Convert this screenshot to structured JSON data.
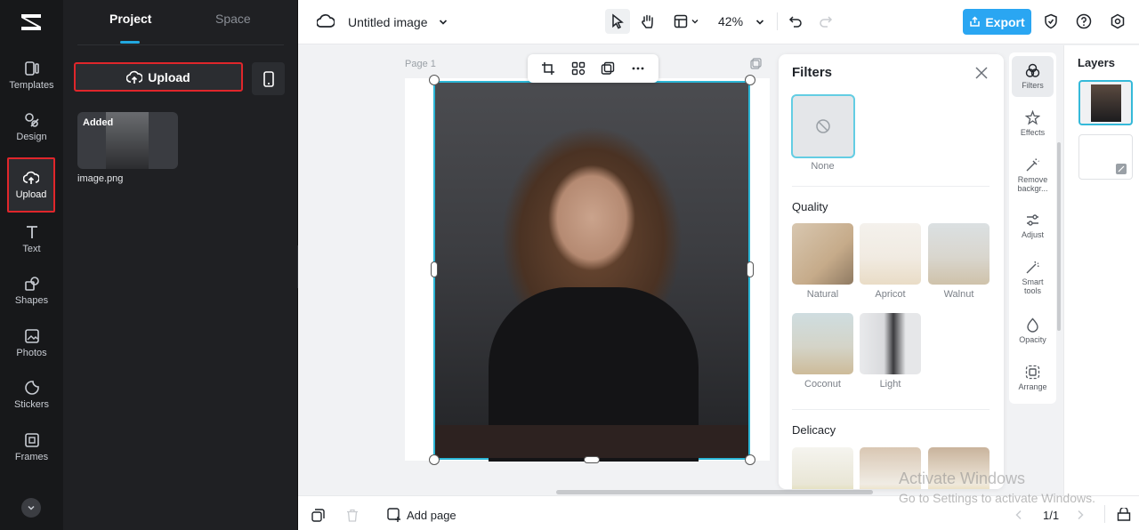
{
  "rail": {
    "items": [
      {
        "label": "Templates",
        "icon": "templates-icon"
      },
      {
        "label": "Design",
        "icon": "design-icon"
      },
      {
        "label": "Upload",
        "icon": "upload-cloud-icon"
      },
      {
        "label": "Text",
        "icon": "text-icon"
      },
      {
        "label": "Shapes",
        "icon": "shapes-icon"
      },
      {
        "label": "Photos",
        "icon": "photos-icon"
      },
      {
        "label": "Stickers",
        "icon": "stickers-icon"
      },
      {
        "label": "Frames",
        "icon": "frames-icon"
      }
    ]
  },
  "panel": {
    "tab_project": "Project",
    "tab_space": "Space",
    "upload_label": "Upload",
    "asset_badge": "Added",
    "asset_name": "image.png"
  },
  "topbar": {
    "title": "Untitled image",
    "zoom": "42%",
    "export_label": "Export"
  },
  "canvas": {
    "page_label": "Page 1"
  },
  "filters": {
    "title": "Filters",
    "none_label": "None",
    "sections": [
      {
        "title": "Quality",
        "items": [
          "Natural",
          "Apricot",
          "Walnut",
          "Coconut",
          "Light"
        ]
      },
      {
        "title": "Delicacy",
        "items": []
      }
    ]
  },
  "tools": [
    {
      "label": "Filters",
      "icon": "filters-icon"
    },
    {
      "label": "Effects",
      "icon": "effects-icon"
    },
    {
      "label": "Remove backgr...",
      "icon": "remove-background-icon"
    },
    {
      "label": "Adjust",
      "icon": "adjust-icon"
    },
    {
      "label": "Smart tools",
      "icon": "smart-tools-icon"
    },
    {
      "label": "Opacity",
      "icon": "opacity-icon"
    },
    {
      "label": "Arrange",
      "icon": "arrange-icon"
    }
  ],
  "layers": {
    "title": "Layers"
  },
  "bottombar": {
    "add_page": "Add page",
    "page_count": "1/1"
  },
  "watermark": {
    "line1": "Activate Windows",
    "line2": "Go to Settings to activate Windows."
  },
  "colors": {
    "accent": "#2aa6f2",
    "selection": "#2bb6d6",
    "highlight_box": "#e0262b"
  }
}
